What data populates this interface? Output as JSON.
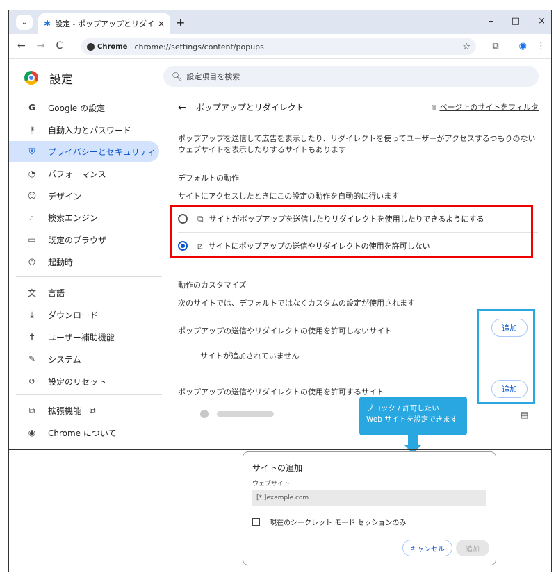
{
  "browser": {
    "tab_title": "設定 - ポップアップとリダイレクト",
    "tab_close": "×",
    "new_tab": "+",
    "url_chip": "Chrome",
    "url": "chrome://settings/content/popups",
    "window_controls": [
      "–",
      "□",
      "×"
    ]
  },
  "header": {
    "title": "設定",
    "search_placeholder": "設定項目を検索"
  },
  "sidebar": {
    "items": [
      {
        "label": "Google の設定",
        "icon": "google-g-icon"
      },
      {
        "label": "自動入力とパスワード",
        "icon": "key-icon"
      },
      {
        "label": "プライバシーとセキュリティ",
        "icon": "shield-icon"
      },
      {
        "label": "パフォーマンス",
        "icon": "speedometer-icon"
      },
      {
        "label": "デザイン",
        "icon": "palette-icon"
      },
      {
        "label": "検索エンジン",
        "icon": "search-icon"
      },
      {
        "label": "既定のブラウザ",
        "icon": "browser-window-icon"
      },
      {
        "label": "起動時",
        "icon": "power-icon"
      },
      {
        "label": "言語",
        "icon": "translate-icon"
      },
      {
        "label": "ダウンロード",
        "icon": "download-icon"
      },
      {
        "label": "ユーザー補助機能",
        "icon": "accessibility-icon"
      },
      {
        "label": "システム",
        "icon": "wrench-icon"
      },
      {
        "label": "設定のリセット",
        "icon": "reset-icon"
      },
      {
        "label": "拡張機能",
        "icon": "puzzle-icon"
      },
      {
        "label": "Chrome について",
        "icon": "chrome-icon"
      }
    ]
  },
  "main": {
    "page_title": "ポップアップとリダイレクト",
    "filter_link": "ページ上のサイトをフィルタ",
    "description": "ポップアップを送信して広告を表示したり、リダイレクトを使ってユーザーがアクセスするつもりのないウェブサイトを表示したりするサイトもあります",
    "default_heading": "デフォルトの動作",
    "default_sub": "サイトにアクセスしたときにこの設定の動作を自動的に行います",
    "option_allow": "サイトがポップアップを送信したりリダイレクトを使用したりできるようにする",
    "option_block": "サイトにポップアップの送信やリダイレクトの使用を許可しない",
    "selected_option": "block",
    "custom_heading": "動作のカスタマイズ",
    "custom_sub": "次のサイトでは、デフォルトではなくカスタムの設定が使用されます",
    "block_list_heading": "ポップアップの送信やリダイレクトの使用を許可しないサイト",
    "block_list_empty": "サイトが追加されていません",
    "allow_list_heading": "ポップアップの送信やリダイレクトの使用を許可するサイト",
    "add_label": "追加"
  },
  "callout": {
    "line1": "ブロック / 許可したい",
    "line2": "Web サイトを設定できます"
  },
  "dialog": {
    "title": "サイトの追加",
    "field_label": "ウェブサイト",
    "field_placeholder": "[*.]example.com",
    "checkbox_label": "現在のシークレット モード セッションのみ",
    "cancel_label": "キャンセル",
    "add_label": "追加"
  },
  "colors": {
    "accent": "#0b57d0",
    "highlight_red": "#e00000",
    "highlight_blue": "#29a7e1",
    "active_nav_bg": "#d3e3fd"
  }
}
